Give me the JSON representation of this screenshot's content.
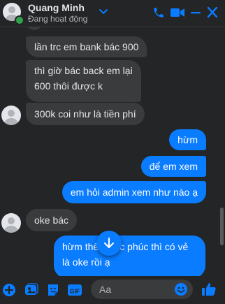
{
  "header": {
    "name": "Quang Minh",
    "status": "Đang hoạt động"
  },
  "messages": [
    {
      "side": "in",
      "text": "lần trc em bank bác 900"
    },
    {
      "side": "in",
      "lines": [
        "thì giờ bác back em lại",
        "600 thôi được k"
      ]
    },
    {
      "side": "in",
      "text": "300k coi như là tiền phí"
    },
    {
      "side": "out",
      "text": "hừm"
    },
    {
      "side": "out",
      "text": "để em xem"
    },
    {
      "side": "out",
      "text": "em hỏi admin xem như nào ạ"
    },
    {
      "side": "in",
      "text": "oke bác"
    },
    {
      "side": "out",
      "lines": [
        "hừm thế",
        "c phúc thì có vẻ",
        "là oke rồi ạ"
      ]
    }
  ],
  "composer": {
    "placeholder": "Aa"
  },
  "icons": [
    "phone-icon",
    "video-icon",
    "minimize-icon",
    "close-icon",
    "plus-icon",
    "photo-icon",
    "sticker-icon",
    "gif-icon",
    "emoji-icon",
    "like-icon",
    "arrow-down-icon"
  ],
  "colors": {
    "accent": "#0a7cff",
    "background": "#242526",
    "incoming": "#3a3b3c",
    "online": "#31a24c"
  }
}
